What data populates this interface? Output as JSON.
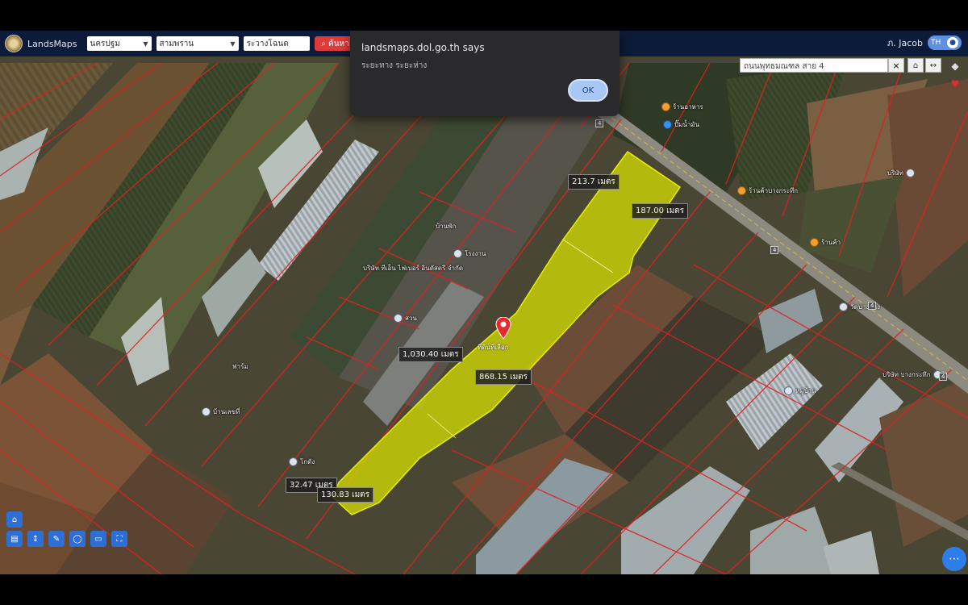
{
  "toolbar": {
    "app_name": "LandsMaps",
    "province_value": "นครปฐม",
    "district_value": "สามพราน",
    "parcel_input_value": "ระวางโฉนด",
    "search_button_label": "ค้นหา",
    "user_name": "ภ. Jacob",
    "toggle_label": "TH"
  },
  "dialog": {
    "title": "landsmaps.dol.go.th says",
    "message": "ระยะทาง ระยะห่าง",
    "ok_label": "OK"
  },
  "map_search": {
    "value": "ถนนพุทธมณฑล สาย 4",
    "clear_icon": "×"
  },
  "parcel": {
    "pin_label": "ที่ดินที่เลือก",
    "measurements": [
      {
        "label": "213.7 เมตร"
      },
      {
        "label": "187.00 เมตร"
      },
      {
        "label": "1,030.40 เมตร"
      },
      {
        "label": "868.15 เมตร"
      },
      {
        "label": "32.47 เมตร"
      },
      {
        "label": "130.83 เมตร"
      }
    ],
    "highlight_color": "#d8e000"
  },
  "pois": [
    {
      "label": "ร้านอาหาร",
      "kind": "orange"
    },
    {
      "label": "ปั๊มน้ำมัน",
      "kind": "blue"
    },
    {
      "label": "ร้านค้าบางกระทึก",
      "kind": "orange"
    },
    {
      "label": "บริษัท",
      "kind": "grey"
    },
    {
      "label": "บริษัท ทีเอ็น ไฟเบอร์ อินดัสตรี จำกัด",
      "kind": "grey"
    },
    {
      "label": "โรงงาน",
      "kind": "grey"
    },
    {
      "label": "บ้านพัก",
      "kind": "grey"
    },
    {
      "label": "ฟาร์ม",
      "kind": "grey"
    },
    {
      "label": "บ้านเลขที่",
      "kind": "grey"
    },
    {
      "label": "ร้านค้า",
      "kind": "orange"
    },
    {
      "label": "วัดบางช้าง",
      "kind": "grey"
    },
    {
      "label": "หมู่บ้าน",
      "kind": "grey"
    },
    {
      "label": "สวน",
      "kind": "grey"
    },
    {
      "label": "โกดัง",
      "kind": "grey"
    },
    {
      "label": "บริษัท บางกระทึก",
      "kind": "grey"
    }
  ],
  "road_signs": [
    "4",
    "4",
    "4",
    "4"
  ],
  "tools": {
    "left": [
      "home-icon",
      "layers-icon",
      "measure-icon",
      "draw-icon",
      "print-icon",
      "fullscreen-icon",
      "locate-icon"
    ],
    "fab_icon": "more-icon"
  },
  "colors": {
    "toolbar_bg": "#0c1b3a",
    "search_button": "#e03b3b",
    "parcel_border": "#e02020",
    "accent_blue": "#2e6fd6"
  }
}
